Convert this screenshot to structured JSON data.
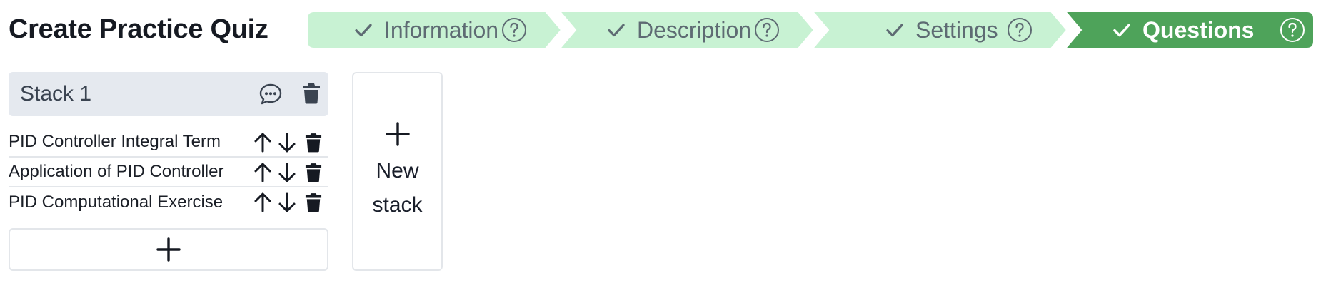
{
  "page": {
    "title": "Create Practice Quiz"
  },
  "stepper": {
    "steps": [
      {
        "label": "Information",
        "state": "done"
      },
      {
        "label": "Description",
        "state": "done"
      },
      {
        "label": "Settings",
        "state": "done"
      },
      {
        "label": "Questions",
        "state": "active"
      }
    ],
    "colors": {
      "done_bg": "#c8f2d3",
      "active_bg": "#4ea35a",
      "done_text": "#5e6b73",
      "active_text": "#ffffff"
    },
    "icons": {
      "check": "check-icon",
      "help": "help-circle-icon"
    }
  },
  "stack": {
    "title": "Stack 1",
    "icons": [
      "comment-icon",
      "trash-icon"
    ],
    "questions": [
      {
        "label": "PID Controller Integral Term"
      },
      {
        "label": "Application of PID Controller"
      },
      {
        "label": "PID Computational Exercise"
      }
    ],
    "add_icon": "plus-icon"
  },
  "new_stack": {
    "line1": "New",
    "line2": "stack",
    "icon": "plus-icon"
  }
}
